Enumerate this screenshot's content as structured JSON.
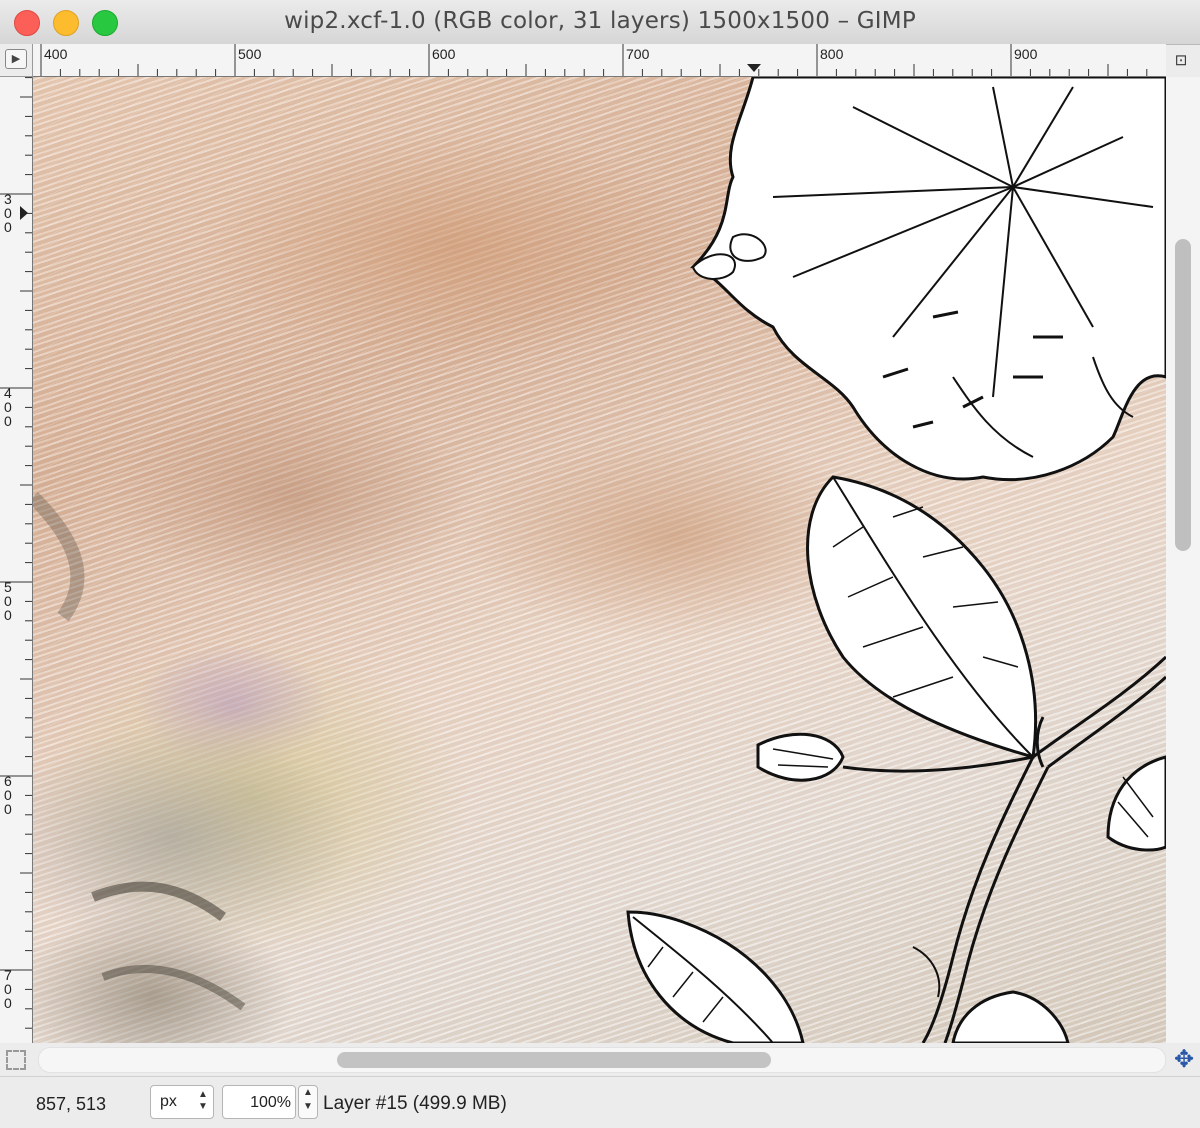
{
  "window": {
    "title": "wip2.xcf-1.0 (RGB color, 31 layers) 1500x1500 – GIMP"
  },
  "rulers": {
    "horizontal_labels": [
      "400",
      "500",
      "600",
      "700",
      "800",
      "900"
    ],
    "vertical_labels": [
      "300",
      "400",
      "500",
      "600",
      "700"
    ]
  },
  "icons": {
    "menu": "menu-arrow-icon",
    "zoom": "zoom-icon",
    "quick_mask": "quick-mask-icon",
    "navigate": "navigate-icon"
  },
  "statusbar": {
    "coordinates": "857, 513",
    "unit": "px",
    "zoom": "100%",
    "layer_info": "Layer #15 (499.9 MB)"
  },
  "colors": {
    "close": "#fc5f57",
    "minimize": "#fdbc2e",
    "maximize": "#28c840",
    "navigate_icon": "#2958a8"
  }
}
